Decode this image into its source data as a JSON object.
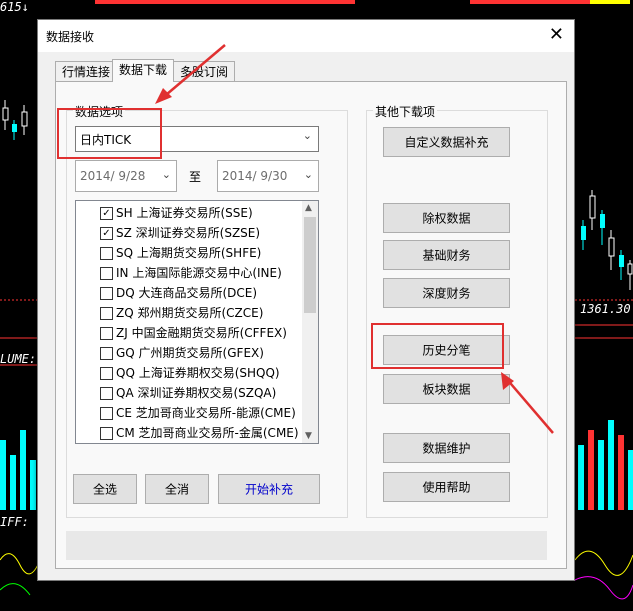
{
  "background": {
    "top_ticker": "615↓",
    "price_label": "1361.30",
    "indicator_label_1": "LUME:",
    "indicator_label_2": "IFF:"
  },
  "dialog": {
    "title": "数据接收",
    "close_glyph": "✕",
    "tabs": [
      {
        "label": "行情连接"
      },
      {
        "label": "数据下载"
      },
      {
        "label": "多股订阅"
      }
    ],
    "data_options": {
      "group_label": "数据选项",
      "selected_type": "日内TICK",
      "start_date": "2014/ 9/28",
      "to_label": "至",
      "end_date": "2014/ 9/30",
      "exchanges": [
        {
          "label": "SH 上海证券交易所(SSE)",
          "checked": true
        },
        {
          "label": "SZ 深圳证券交易所(SZSE)",
          "checked": true
        },
        {
          "label": "SQ 上海期货交易所(SHFE)",
          "checked": false
        },
        {
          "label": "IN 上海国际能源交易中心(INE)",
          "checked": false
        },
        {
          "label": "DQ 大连商品交易所(DCE)",
          "checked": false
        },
        {
          "label": "ZQ 郑州期货交易所(CZCE)",
          "checked": false
        },
        {
          "label": "ZJ 中国金融期货交易所(CFFEX)",
          "checked": false
        },
        {
          "label": "GQ 广州期货交易所(GFEX)",
          "checked": false
        },
        {
          "label": "QQ 上海证券期权交易(SHQQ)",
          "checked": false
        },
        {
          "label": "QA 深圳证券期权交易(SZQA)",
          "checked": false
        },
        {
          "label": "CE 芝加哥商业交易所-能源(CME)",
          "checked": false
        },
        {
          "label": "CM 芝加哥商业交易所-金属(CME)",
          "checked": false
        }
      ],
      "select_all_label": "全选",
      "deselect_all_label": "全消",
      "start_label": "开始补充"
    },
    "other_downloads": {
      "group_label": "其他下载项",
      "buttons": [
        {
          "label": "自定义数据补充"
        },
        {
          "label": "除权数据"
        },
        {
          "label": "基础财务"
        },
        {
          "label": "深度财务"
        },
        {
          "label": "历史分笔"
        },
        {
          "label": "板块数据"
        },
        {
          "label": "数据维护"
        },
        {
          "label": "使用帮助"
        }
      ]
    }
  },
  "colors": {
    "annotation": "#e03030",
    "accent_blue": "#0000cc"
  }
}
